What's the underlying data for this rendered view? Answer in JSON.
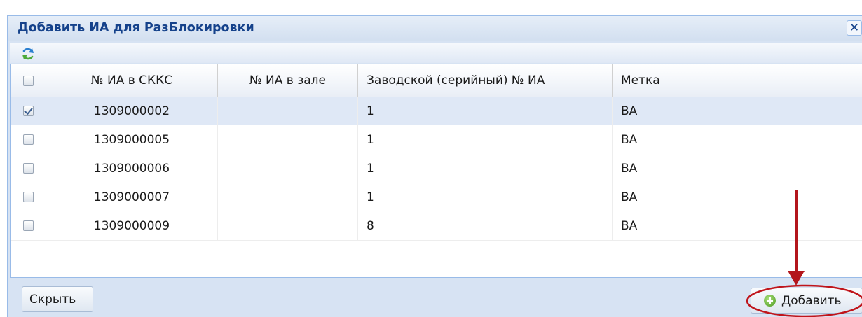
{
  "dialog": {
    "title": "Добавить ИА для РазБлокировки",
    "close_label": "✕"
  },
  "toolbar": {
    "refresh_icon": "refresh-icon"
  },
  "grid": {
    "columns": [
      "",
      "№ ИА в СККС",
      "№ ИА в зале",
      "Заводской (серийный) № ИА",
      "Метка"
    ],
    "rows": [
      {
        "selected": true,
        "sccs": "1309000002",
        "hall": "",
        "serial": "1",
        "mark": "ВА"
      },
      {
        "selected": false,
        "sccs": "1309000005",
        "hall": "",
        "serial": "1",
        "mark": "ВА"
      },
      {
        "selected": false,
        "sccs": "1309000006",
        "hall": "",
        "serial": "1",
        "mark": "ВА"
      },
      {
        "selected": false,
        "sccs": "1309000007",
        "hall": "",
        "serial": "1",
        "mark": "ВА"
      },
      {
        "selected": false,
        "sccs": "1309000009",
        "hall": "",
        "serial": "8",
        "mark": "ВА"
      }
    ]
  },
  "footer": {
    "hide_label": "Скрыть",
    "add_label": "Добавить"
  },
  "colors": {
    "title": "#15428b",
    "annotation": "#c0151b",
    "selected_row": "#dfe8f6"
  }
}
